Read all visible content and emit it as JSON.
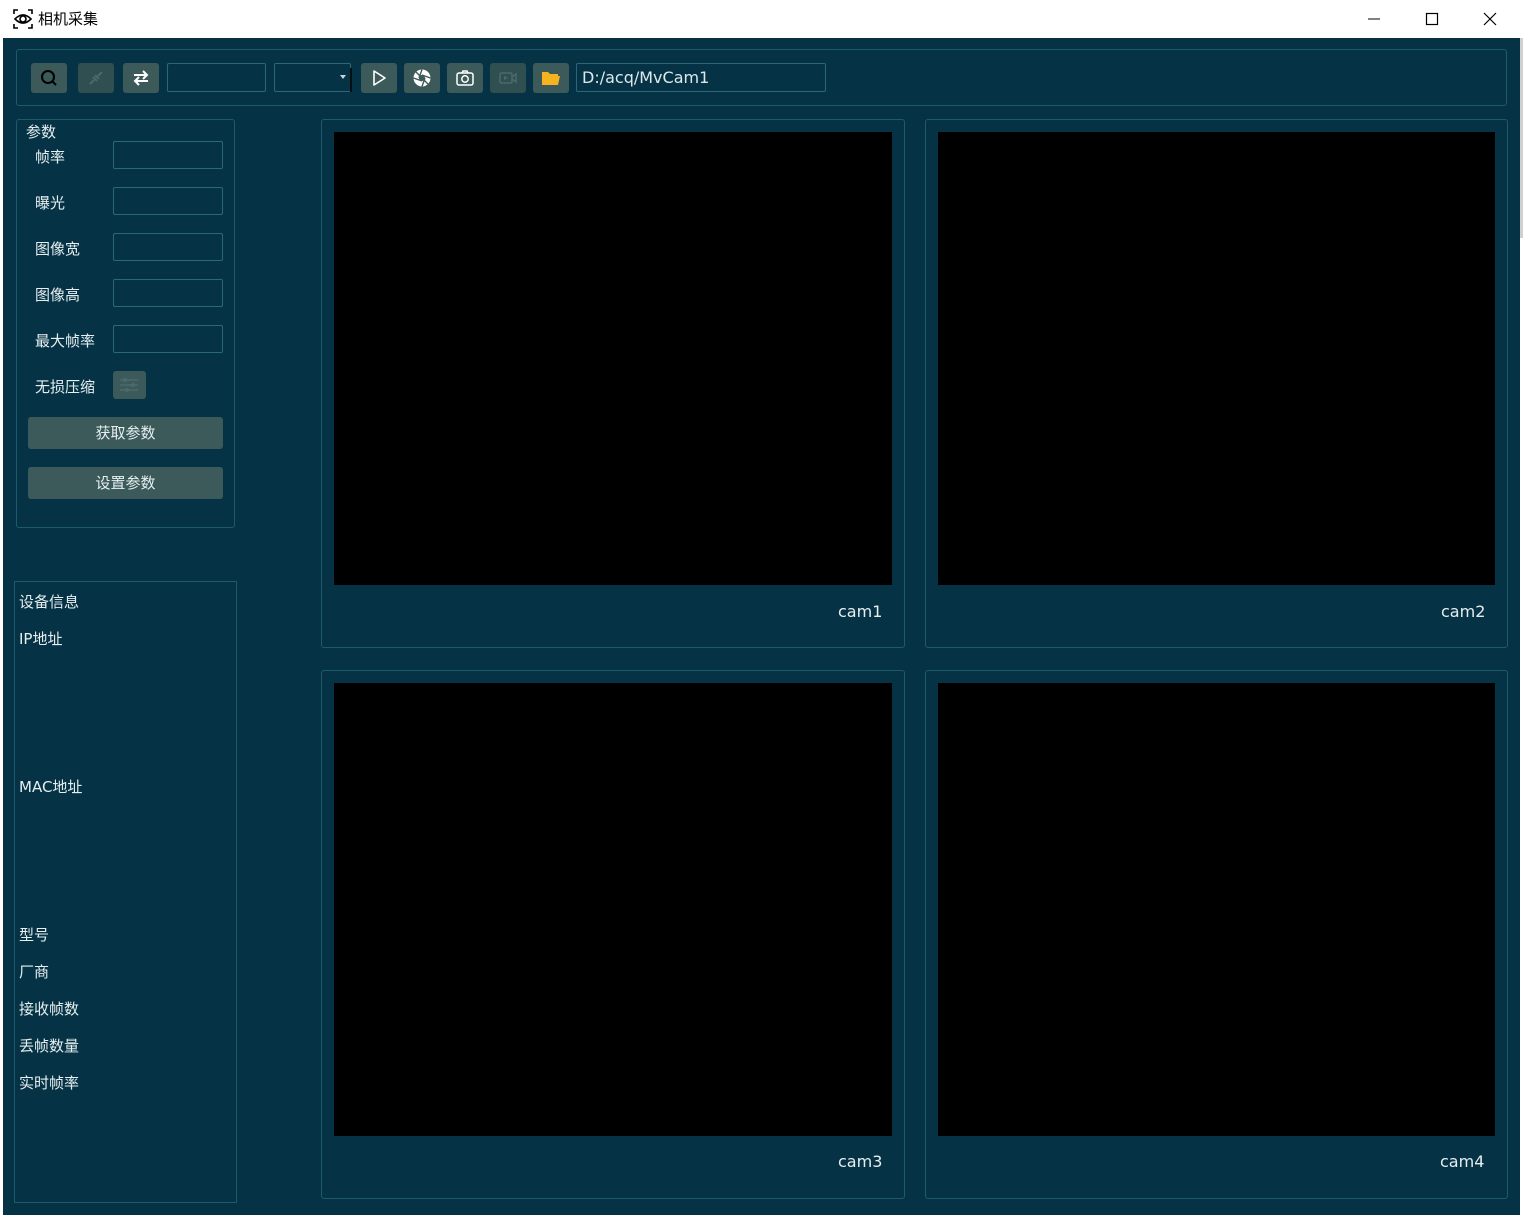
{
  "window": {
    "title": "相机采集",
    "controls": [
      "minimize",
      "maximize",
      "close"
    ]
  },
  "toolbar": {
    "camera_id_value": "",
    "combo_value": "",
    "save_path": "D:/acq/MvCam1",
    "icons": [
      "search-icon",
      "link-icon",
      "swap-icon",
      "play-icon",
      "shutter-icon",
      "camera-icon",
      "video-icon",
      "folder-icon"
    ]
  },
  "params": {
    "title": "参数",
    "frame_rate_label": "帧率",
    "exposure_label": "曝光",
    "width_label": "图像宽",
    "height_label": "图像高",
    "max_fps_label": "最大帧率",
    "lossless_label": "无损压缩",
    "get_button": "获取参数",
    "set_button": "设置参数"
  },
  "info": {
    "title": "设备信息",
    "ip_label": "IP地址",
    "mac_label": "MAC地址",
    "model_label": "型号",
    "vendor_label": "厂商",
    "received_label": "接收帧数",
    "dropped_label": "丢帧数量",
    "fps_label": "实时帧率"
  },
  "cams": {
    "cam1": "cam1",
    "cam2": "cam2",
    "cam3": "cam3",
    "cam4": "cam4"
  },
  "colors": {
    "background": "#053345",
    "border": "#1d5a6a",
    "button": "#3c5a5a",
    "folder": "#f5b31f",
    "text": "#e6eef0"
  }
}
